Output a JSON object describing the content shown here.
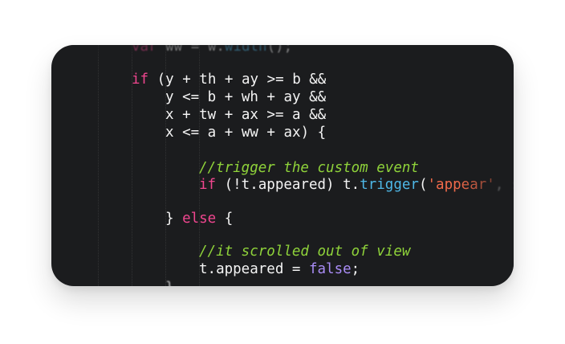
{
  "code": {
    "line0": {
      "kw": "var",
      "rest": " ww = w.",
      "fn": "width",
      "tail": "();"
    },
    "line1": {
      "kw": "if",
      "rest": " (y + th + ay >= b &&"
    },
    "line2": {
      "text": "y <= b + wh + ay &&"
    },
    "line3": {
      "text": "x + tw + ax >= a &&"
    },
    "line4": {
      "text": "x <= a + ww + ax) {"
    },
    "line5": {
      "comment": "//trigger the custom event"
    },
    "line6": {
      "kw": "if",
      "mid": " (!t.appeared) t.",
      "fn": "trigger",
      "open": "(",
      "str": "'appear'",
      "tail": ", settin"
    },
    "line7": {
      "brace": "} ",
      "kw": "else",
      "tail": " {"
    },
    "line8": {
      "comment": "//it scrolled out of view"
    },
    "line9": {
      "pre": "t.appeared = ",
      "bool": "false",
      "tail": ";"
    },
    "line10": {
      "text": "}"
    }
  },
  "colors": {
    "background": "#1b1c1e",
    "keyword": "#f0468f",
    "function": "#4eb7e6",
    "comment": "#8fd33a",
    "string": "#f06a4a",
    "boolean": "#a98cf5",
    "text": "#f4f4f4"
  }
}
